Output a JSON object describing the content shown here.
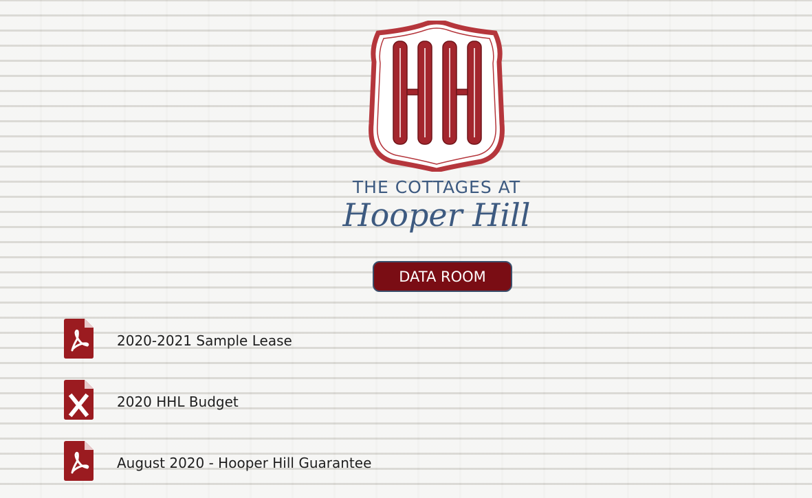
{
  "logo": {
    "monogram": "HH",
    "tagline_top": "THE COTTAGES AT",
    "tagline_script": "Hooper Hill",
    "colors": {
      "crest_red": "#a3262d",
      "crest_border": "#b5363c",
      "text_navy": "#3d5a80"
    }
  },
  "data_room_button": {
    "label": "DATA ROOM",
    "color": "#7a0d14"
  },
  "documents": [
    {
      "icon": "pdf-file-icon",
      "label": "2020-2021 Sample Lease"
    },
    {
      "icon": "excel-file-icon",
      "label": "2020 HHL Budget"
    },
    {
      "icon": "pdf-file-icon",
      "label": "August 2020 - Hooper Hill Guarantee"
    }
  ],
  "icon_color": "#9b1b20"
}
